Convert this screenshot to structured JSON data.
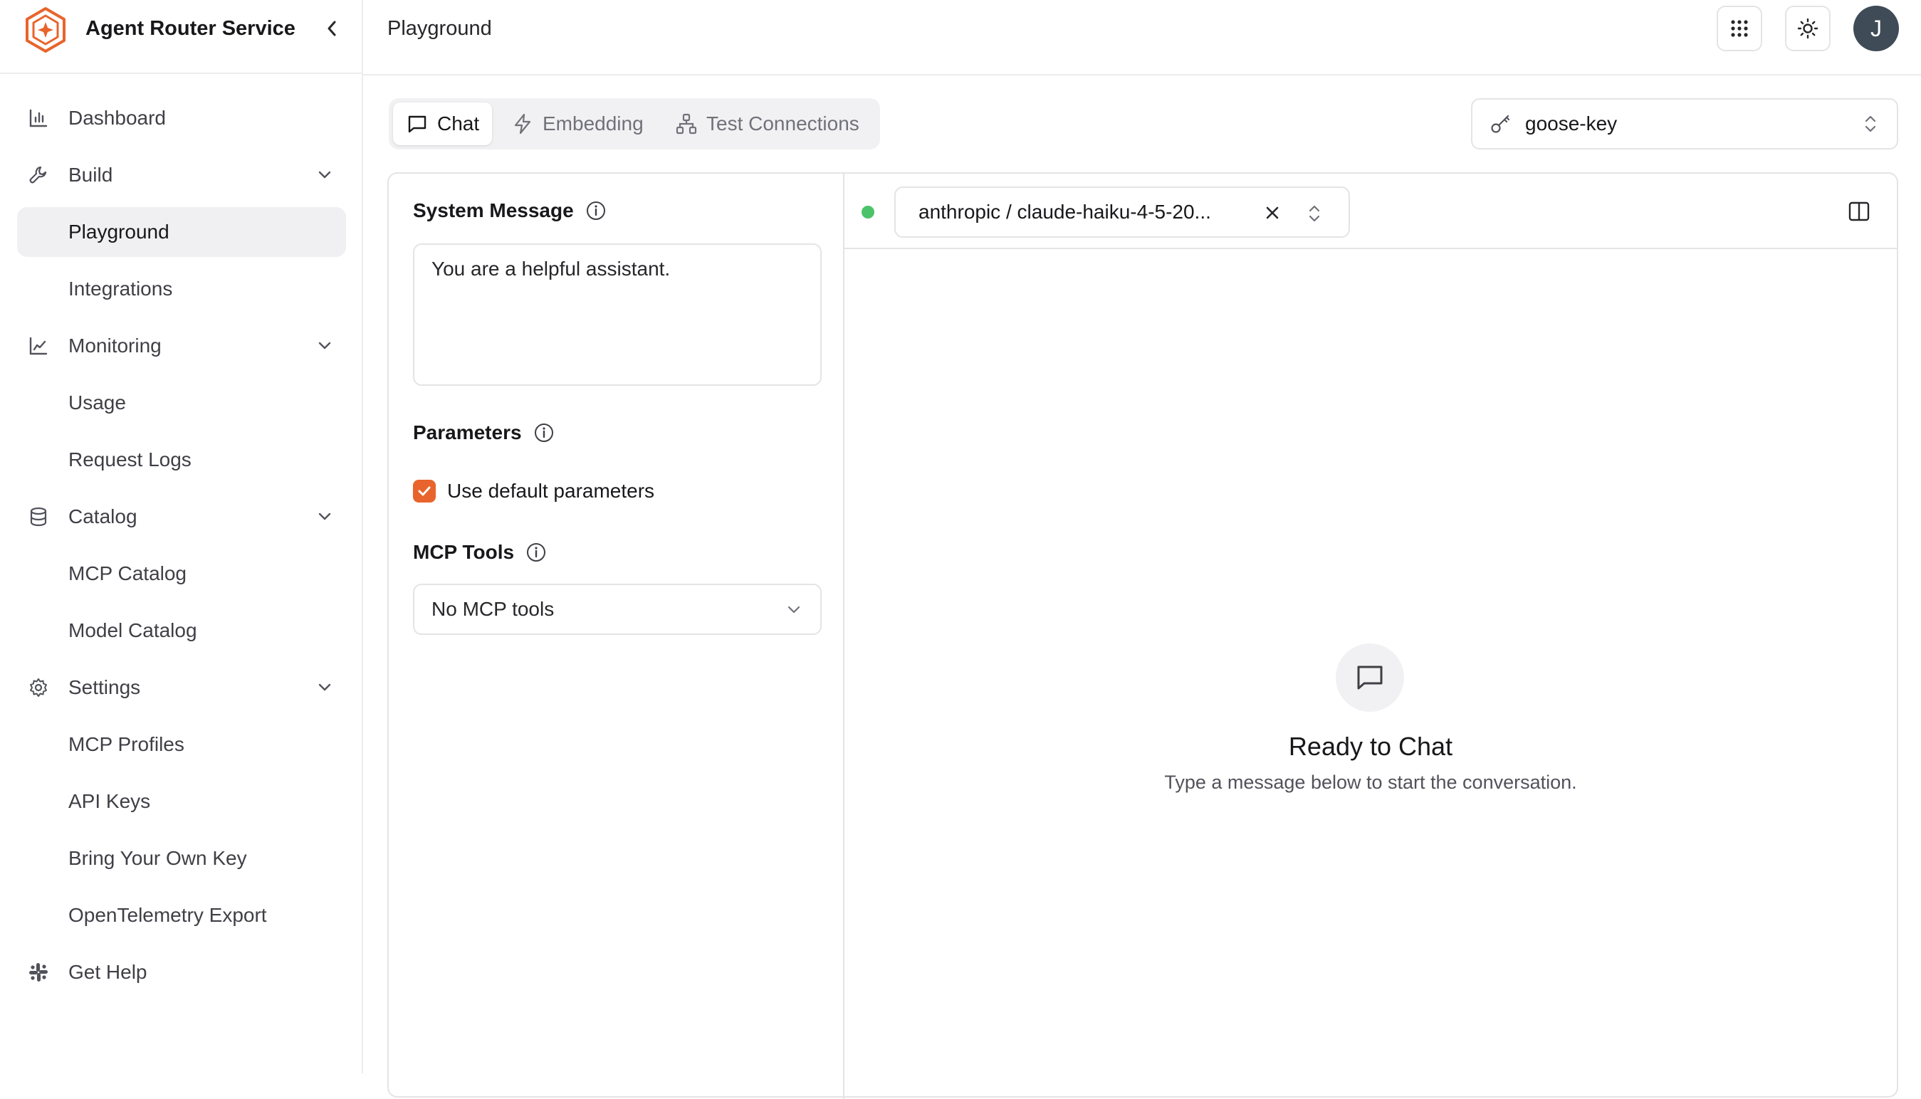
{
  "app": {
    "title": "Agent Router Service"
  },
  "header": {
    "page_title": "Playground",
    "avatar_initial": "J"
  },
  "sidebar": {
    "items": [
      {
        "label": "Dashboard"
      },
      {
        "label": "Build"
      },
      {
        "label": "Playground"
      },
      {
        "label": "Integrations"
      },
      {
        "label": "Monitoring"
      },
      {
        "label": "Usage"
      },
      {
        "label": "Request Logs"
      },
      {
        "label": "Catalog"
      },
      {
        "label": "MCP Catalog"
      },
      {
        "label": "Model Catalog"
      },
      {
        "label": "Settings"
      },
      {
        "label": "MCP Profiles"
      },
      {
        "label": "API Keys"
      },
      {
        "label": "Bring Your Own Key"
      },
      {
        "label": "OpenTelemetry Export"
      },
      {
        "label": "Get Help"
      }
    ],
    "active": "Playground"
  },
  "tabs": [
    {
      "label": "Chat",
      "active": true
    },
    {
      "label": "Embedding",
      "active": false
    },
    {
      "label": "Test Connections",
      "active": false
    }
  ],
  "key_select": {
    "value": "goose-key"
  },
  "left_panel": {
    "system_message_label": "System Message",
    "system_message_value": "You are a helpful assistant.",
    "parameters_label": "Parameters",
    "use_default_label": "Use default parameters",
    "use_default_checked": true,
    "mcp_tools_label": "MCP Tools",
    "mcp_tools_value": "No MCP tools"
  },
  "chat": {
    "model_value": "anthropic / claude-haiku-4-5-20...",
    "status": "connected",
    "empty_title": "Ready to Chat",
    "empty_subtitle": "Type a message below to start the conversation."
  },
  "colors": {
    "accent": "#e8642c",
    "status_green": "#4cc36b",
    "avatar_bg": "#3f4b56",
    "border": "#e4e4e7"
  }
}
